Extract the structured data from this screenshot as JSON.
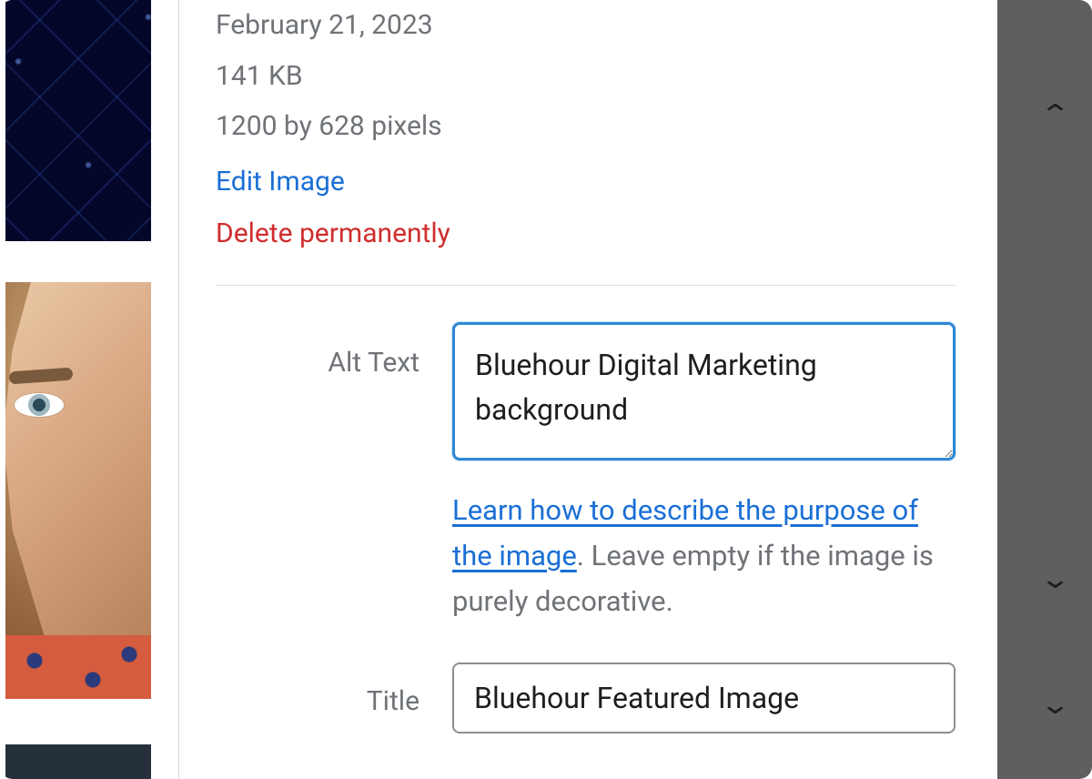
{
  "meta": {
    "date": "February 21, 2023",
    "size": "141 KB",
    "dimensions": "1200 by 628 pixels",
    "edit_label": "Edit Image",
    "delete_label": "Delete permanently"
  },
  "fields": {
    "alt_label": "Alt Text",
    "alt_value": "Bluehour Digital Marketing background ",
    "alt_help_link": "Learn how to describe the purpose of the image",
    "alt_help_suffix": ". Leave empty if the image is purely decorative.",
    "title_label": "Title",
    "title_value": "Bluehour Featured Image"
  },
  "thumbs": [
    {
      "name": "grid-pattern-thumbnail"
    },
    {
      "name": "portrait-thumbnail"
    },
    {
      "name": "dark-thumbnail"
    }
  ]
}
